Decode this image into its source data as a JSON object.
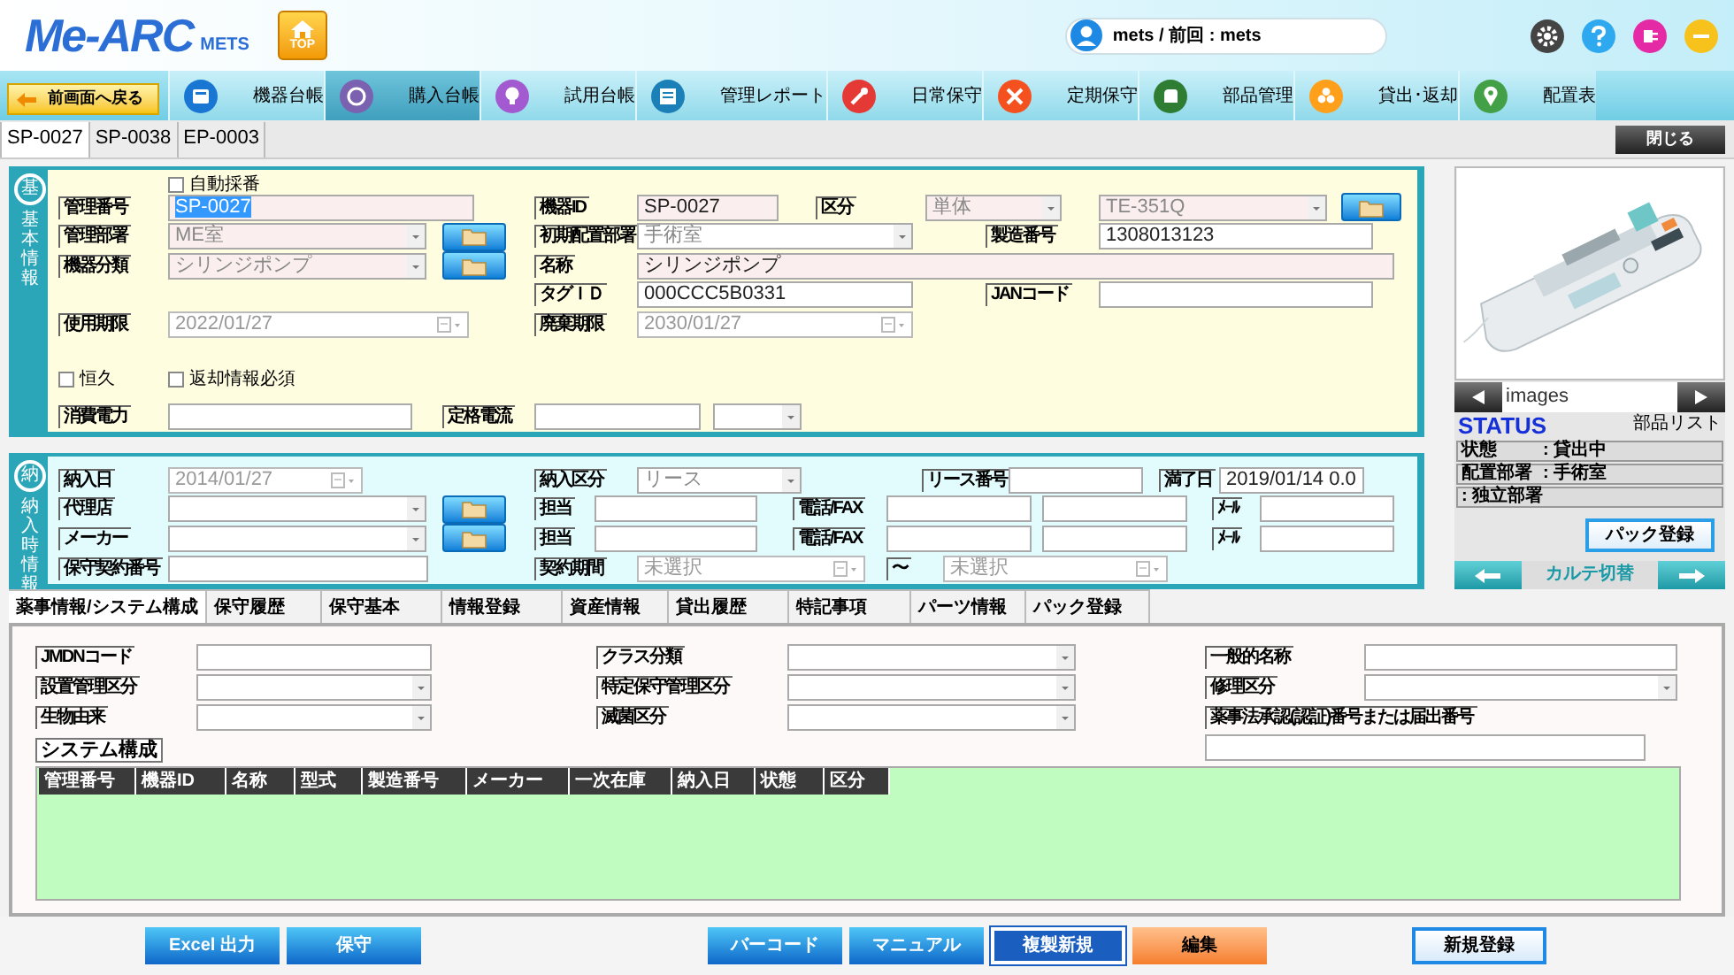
{
  "header": {
    "logo": "Me-ARC",
    "brand": "METS",
    "top_button": "TOP",
    "user": "mets / 前回 : mets"
  },
  "nav": {
    "back_button": "前画面へ戻る",
    "items": [
      {
        "label": "機器台帳",
        "selected": false
      },
      {
        "label": "購入台帳",
        "selected": true
      },
      {
        "label": "試用台帳",
        "selected": false
      },
      {
        "label": "管理レポート",
        "selected": false
      },
      {
        "label": "日常保守",
        "selected": false
      },
      {
        "label": "定期保守",
        "selected": false
      },
      {
        "label": "部品管理",
        "selected": false
      },
      {
        "label": "貸出･返却",
        "selected": false
      },
      {
        "label": "配置表",
        "selected": false
      }
    ]
  },
  "record_tabs": [
    {
      "label": "SP-0027",
      "selected": true
    },
    {
      "label": "SP-0038",
      "selected": false
    },
    {
      "label": "EP-0003",
      "selected": false
    }
  ],
  "close_button": "閉じる",
  "basic": {
    "badge": "基",
    "side_label": "基本情報",
    "rows": [
      {
        "fields": [
          {
            "kind": "checkbox",
            "label": "自動採番",
            "checked": false
          }
        ]
      },
      {
        "fields": [
          {
            "kind": "label",
            "text": "管理番号"
          },
          {
            "kind": "input",
            "value": "SP-0027",
            "readonly": true,
            "text_selected": true
          },
          {
            "kind": "label",
            "text": "機器ID"
          },
          {
            "kind": "input",
            "value": "SP-0027",
            "readonly": true
          },
          {
            "kind": "label",
            "text": "区分"
          },
          {
            "kind": "select",
            "value": "単体",
            "readonly": true
          },
          {
            "kind": "select",
            "value": "TE-351Q",
            "readonly": true
          },
          {
            "kind": "folder"
          }
        ]
      },
      {
        "fields": [
          {
            "kind": "label",
            "text": "管理部署"
          },
          {
            "kind": "select",
            "value": "ME室",
            "readonly": true
          },
          {
            "kind": "folder"
          },
          {
            "kind": "label",
            "text": "初期配置部署"
          },
          {
            "kind": "select",
            "value": "手術室",
            "readonly": false
          },
          {
            "kind": "label",
            "text": "製造番号"
          },
          {
            "kind": "input",
            "value": "1308013123",
            "readonly": false
          }
        ]
      },
      {
        "fields": [
          {
            "kind": "label",
            "text": "機器分類"
          },
          {
            "kind": "select",
            "value": "シリンジポンプ",
            "readonly": true
          },
          {
            "kind": "folder"
          },
          {
            "kind": "label",
            "text": "名称"
          },
          {
            "kind": "input",
            "value": "シリンジポンプ",
            "readonly": true
          }
        ]
      },
      {
        "fields": [
          {
            "kind": "label",
            "text": "タグＩＤ"
          },
          {
            "kind": "input",
            "value": "000CCC5B0331",
            "readonly": false
          },
          {
            "kind": "label",
            "text": "JANコード"
          },
          {
            "kind": "input",
            "readonly": false
          }
        ]
      },
      {
        "fields": [
          {
            "kind": "label",
            "text": "使用期限"
          },
          {
            "kind": "date",
            "value": "2022/01/27"
          },
          {
            "kind": "label",
            "text": "廃棄期限"
          },
          {
            "kind": "date",
            "value": "2030/01/27"
          }
        ]
      },
      {
        "fields": [
          {
            "kind": "checkbox",
            "label": "恒久",
            "checked": false
          },
          {
            "kind": "checkbox",
            "label": "返却情報必須",
            "checked": false
          }
        ]
      },
      {
        "fields": [
          {
            "kind": "label",
            "text": "消費電力"
          },
          {
            "kind": "input",
            "readonly": false
          },
          {
            "kind": "label",
            "text": "定格電流"
          },
          {
            "kind": "input",
            "readonly": false
          },
          {
            "kind": "select",
            "readonly": false
          }
        ]
      }
    ]
  },
  "delivery": {
    "badge": "納",
    "side_label": "納入時情報",
    "rows": [
      {
        "fields": [
          {
            "kind": "label",
            "text": "納入日"
          },
          {
            "kind": "date",
            "value": "2014/01/27"
          },
          {
            "kind": "label",
            "text": "納入区分"
          },
          {
            "kind": "select",
            "value": "リース",
            "readonly": false
          },
          {
            "kind": "label",
            "text": "リース番号"
          },
          {
            "kind": "input",
            "readonly": false
          },
          {
            "kind": "label",
            "text": "満了日"
          },
          {
            "kind": "input",
            "value": "2019/01/14 0.0",
            "readonly": false
          }
        ]
      },
      {
        "fields": [
          {
            "kind": "label",
            "text": "代理店"
          },
          {
            "kind": "select",
            "readonly": false
          },
          {
            "kind": "folder"
          },
          {
            "kind": "label",
            "text": "担当"
          },
          {
            "kind": "input",
            "readonly": false
          },
          {
            "kind": "label",
            "text": "電話/FAX"
          },
          {
            "kind": "input",
            "readonly": false
          },
          {
            "kind": "input",
            "readonly": false
          },
          {
            "kind": "label",
            "text": "ﾒｰﾙ"
          },
          {
            "kind": "input",
            "readonly": false
          }
        ]
      },
      {
        "fields": [
          {
            "kind": "label",
            "text": "メーカー"
          },
          {
            "kind": "select",
            "readonly": false
          },
          {
            "kind": "folder"
          },
          {
            "kind": "label",
            "text": "担当"
          },
          {
            "kind": "input",
            "readonly": false
          },
          {
            "kind": "label",
            "text": "電話/FAX"
          },
          {
            "kind": "input",
            "readonly": false
          },
          {
            "kind": "input",
            "readonly": false
          },
          {
            "kind": "label",
            "text": "ﾒｰﾙ"
          },
          {
            "kind": "input",
            "readonly": false
          }
        ]
      },
      {
        "fields": [
          {
            "kind": "label",
            "text": "保守契約番号"
          },
          {
            "kind": "input",
            "readonly": false
          },
          {
            "kind": "label",
            "text": "契約期間"
          },
          {
            "kind": "date",
            "value": "未選択"
          },
          {
            "kind": "label",
            "text": "〜"
          },
          {
            "kind": "date",
            "value": "未選択"
          }
        ]
      }
    ]
  },
  "side_panel": {
    "image_caption": "images",
    "status_title": "STATUS",
    "parts_link": "部品リスト",
    "status_rows": [
      {
        "label": "状態",
        "value": ": 貸出中"
      },
      {
        "label": "配置部署",
        "value": ": 手術室"
      },
      {
        "value": ": 独立部署"
      }
    ],
    "pack_button": "パック登録",
    "karte_switch": "カルテ切替"
  },
  "detail_tabs": [
    {
      "label": "薬事情報/システム構成",
      "selected": true
    },
    {
      "label": "保守履歴",
      "selected": false
    },
    {
      "label": "保守基本",
      "selected": false
    },
    {
      "label": "情報登録",
      "selected": false
    },
    {
      "label": "資産情報",
      "selected": false
    },
    {
      "label": "貸出履歴",
      "selected": false
    },
    {
      "label": "特記事項",
      "selected": false
    },
    {
      "label": "パーツ情報",
      "selected": false
    },
    {
      "label": "パック登録",
      "selected": false
    }
  ],
  "detail": {
    "rows": [
      {
        "fields": [
          {
            "kind": "label",
            "text": "JMDNコード"
          },
          {
            "kind": "input",
            "readonly": false
          },
          {
            "kind": "label",
            "text": "クラス分類"
          },
          {
            "kind": "select",
            "readonly": false
          },
          {
            "kind": "label",
            "text": "一般的名称"
          },
          {
            "kind": "input",
            "readonly": false
          }
        ]
      },
      {
        "fields": [
          {
            "kind": "label",
            "text": "設置管理区分"
          },
          {
            "kind": "select",
            "readonly": false
          },
          {
            "kind": "label",
            "text": "特定保守管理区分"
          },
          {
            "kind": "select",
            "readonly": false
          },
          {
            "kind": "label",
            "text": "修理区分"
          },
          {
            "kind": "select",
            "readonly": false
          }
        ]
      },
      {
        "fields": [
          {
            "kind": "label",
            "text": "生物由来"
          },
          {
            "kind": "select",
            "readonly": false
          },
          {
            "kind": "label",
            "text": "滅菌区分"
          },
          {
            "kind": "select",
            "readonly": false
          },
          {
            "kind": "label",
            "text": "薬事法承認(認証)番号または届出番号"
          }
        ]
      },
      {
        "fields": [
          {
            "kind": "input",
            "readonly": false
          }
        ]
      }
    ],
    "system_config": {
      "title": "システム構成",
      "columns": [
        "管理番号",
        "機器ID",
        "名称",
        "型式",
        "製造番号",
        "メーカー",
        "一次在庫",
        "納入日",
        "状態",
        "区分"
      ]
    }
  },
  "buttons": [
    {
      "label": "Excel 出力",
      "kind": "primary"
    },
    {
      "label": "保守",
      "kind": "primary"
    },
    {
      "label": "バーコード",
      "kind": "primary"
    },
    {
      "label": "マニュアル",
      "kind": "primary"
    },
    {
      "label": "複製新規",
      "kind": "outline_dark"
    },
    {
      "label": "編集",
      "kind": "warning"
    },
    {
      "label": "新規登録",
      "kind": "outline_light"
    }
  ]
}
